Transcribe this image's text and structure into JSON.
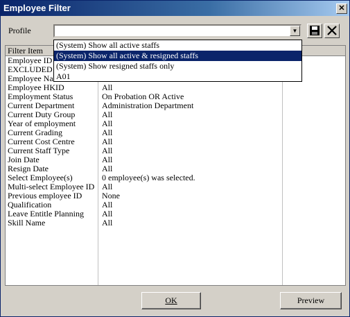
{
  "window": {
    "title": "Employee Filter"
  },
  "profile": {
    "label": "Profile",
    "value": "",
    "options": [
      {
        "label": "(System) Show all active staffs",
        "selected": false
      },
      {
        "label": "(System) Show all active & resigned staffs",
        "selected": true
      },
      {
        "label": "(System) Show resigned staffs only",
        "selected": false
      },
      {
        "label": "A01",
        "selected": false
      }
    ]
  },
  "grid": {
    "columns": [
      "Filter Item",
      ""
    ],
    "rows": [
      [
        "Employee ID",
        ""
      ],
      [
        "EXCLUDED",
        ""
      ],
      [
        "Employee Na",
        ""
      ],
      [
        "Employee HKID",
        "All"
      ],
      [
        "Employment Status",
        "On Probation OR Active"
      ],
      [
        "Current Department",
        "Administration  Department"
      ],
      [
        "Current Duty Group",
        "All"
      ],
      [
        "Year of employment",
        "All"
      ],
      [
        "Current Grading",
        "All"
      ],
      [
        "Current Cost Centre",
        "All"
      ],
      [
        "Current Staff Type",
        "All"
      ],
      [
        "Join Date",
        "All"
      ],
      [
        "Resign Date",
        "All"
      ],
      [
        "Select Employee(s)",
        "0 employee(s) was selected."
      ],
      [
        "Multi-select Employee ID",
        "All"
      ],
      [
        "Previous employee ID",
        "None"
      ],
      [
        "Qualification",
        "All"
      ],
      [
        "Leave Entitle Planning",
        "All"
      ],
      [
        "Skill Name",
        "All"
      ]
    ]
  },
  "buttons": {
    "ok": "OK",
    "preview": "Preview"
  }
}
